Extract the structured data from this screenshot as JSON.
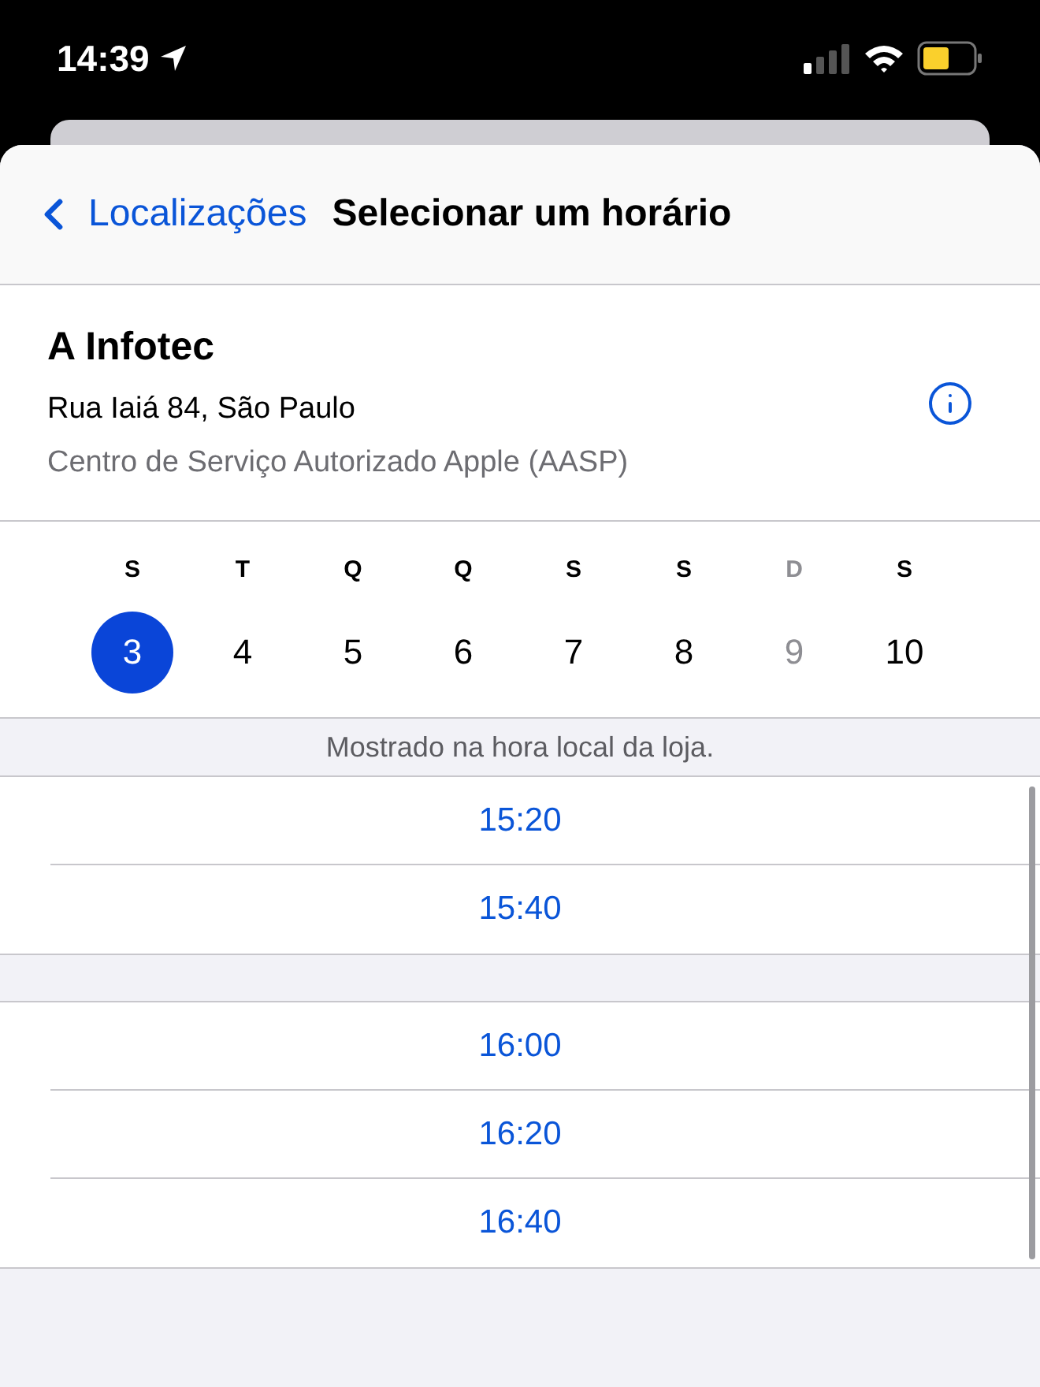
{
  "status_bar": {
    "time": "14:39"
  },
  "nav": {
    "back": "Localizações",
    "title": "Selecionar um horário"
  },
  "store": {
    "name": "A Infotec",
    "address": "Rua Iaiá 84, São Paulo",
    "type": "Centro de Serviço Autorizado Apple (AASP)"
  },
  "days": [
    {
      "weekday": "S",
      "date": "3",
      "selected": true,
      "disabled": false
    },
    {
      "weekday": "T",
      "date": "4",
      "selected": false,
      "disabled": false
    },
    {
      "weekday": "Q",
      "date": "5",
      "selected": false,
      "disabled": false
    },
    {
      "weekday": "Q",
      "date": "6",
      "selected": false,
      "disabled": false
    },
    {
      "weekday": "S",
      "date": "7",
      "selected": false,
      "disabled": false
    },
    {
      "weekday": "S",
      "date": "8",
      "selected": false,
      "disabled": false
    },
    {
      "weekday": "D",
      "date": "9",
      "selected": false,
      "disabled": true
    },
    {
      "weekday": "S",
      "date": "10",
      "selected": false,
      "disabled": false
    }
  ],
  "note": "Mostrado na hora local da loja.",
  "time_groups": [
    [
      "15:20",
      "15:40"
    ],
    [
      "16:00",
      "16:20",
      "16:40"
    ]
  ]
}
